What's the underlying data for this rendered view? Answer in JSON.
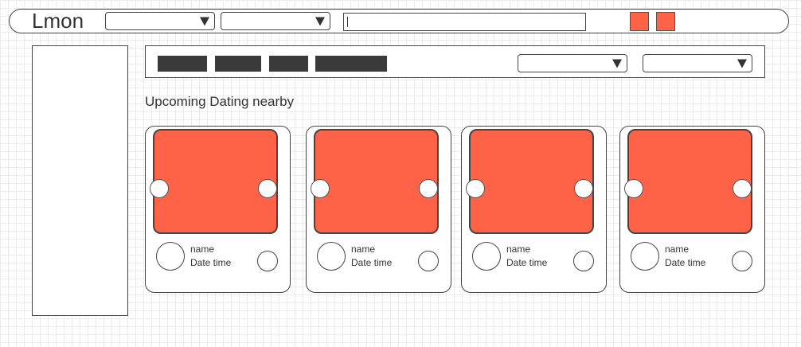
{
  "header": {
    "logo": "Lmon",
    "dropdown_1_value": "",
    "dropdown_2_value": "",
    "search_value": ""
  },
  "toolbar": {
    "dropdown_1_value": "",
    "dropdown_2_value": ""
  },
  "section_title": "Upcoming Dating nearby",
  "cards": [
    {
      "name": "name",
      "datetime": "Date time"
    },
    {
      "name": "name",
      "datetime": "Date time"
    },
    {
      "name": "name",
      "datetime": "Date time"
    },
    {
      "name": "name",
      "datetime": "Date time"
    }
  ],
  "colors": {
    "accent": "#ff6347",
    "tab_fill": "#3a3a3a",
    "outline": "#444444"
  }
}
